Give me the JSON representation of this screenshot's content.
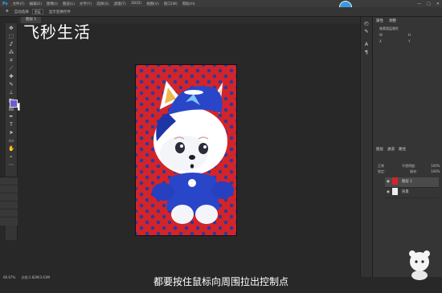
{
  "menubar": {
    "logo": "Ps",
    "items": [
      "文件(F)",
      "编辑(E)",
      "图像(I)",
      "图层(L)",
      "文字(Y)",
      "选择(S)",
      "滤镜(T)",
      "3D(D)",
      "视图(V)",
      "窗口(W)",
      "帮助(H)"
    ],
    "window_controls": [
      "—",
      "□",
      "✕"
    ]
  },
  "options": {
    "auto_select_label": "自动选择",
    "auto_select_value": "图层",
    "show_transform_label": "显示变换控件"
  },
  "document_tab": {
    "label": "图层 1"
  },
  "right_panel": {
    "tabs": [
      "属性",
      "调整"
    ],
    "properties_title": "像素图层属性",
    "fields": [
      "W",
      "H",
      "X",
      "Y"
    ],
    "layers_tabs": [
      "图层",
      "通道",
      "路径"
    ],
    "blend_mode": "正常",
    "opacity_label": "不透明度：",
    "opacity_value": "100%",
    "lock_label": "锁定：",
    "fill_label": "填充：",
    "fill_value": "100%",
    "layers": [
      {
        "name": "图层 1"
      },
      {
        "name": "背景"
      }
    ]
  },
  "status": {
    "zoom": "66.67%",
    "doc_info": "文档:1.82M/3.63M"
  },
  "watermark": "飞秒生活",
  "subtitle": "都要按住鼠标向周围拉出控制点",
  "colors": {
    "canvas_red": "#d3242a",
    "star_blue": "#2a3b9b",
    "panel_bg": "#353535",
    "workspace_bg": "#282828"
  }
}
